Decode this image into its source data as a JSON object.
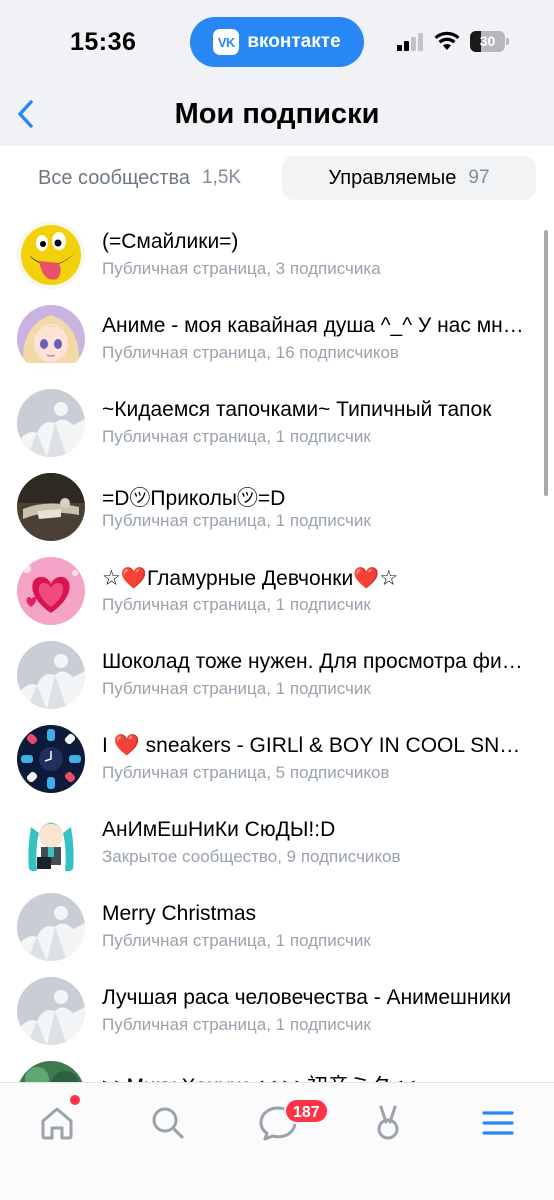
{
  "status_bar": {
    "time": "15:36",
    "app_pill": {
      "logo": "VK",
      "label": "вконтакте"
    },
    "battery_level": "30"
  },
  "header": {
    "title": "Мои подписки"
  },
  "tabs": [
    {
      "label": "Все сообщества",
      "count": "1,5K"
    },
    {
      "label": "Управляемые",
      "count": "97"
    }
  ],
  "communities": [
    {
      "name": "(=Смайлики=)",
      "subtitle": "Публичная страница, 3 подписчика",
      "avatar": "smiley-avatar"
    },
    {
      "name": "Аниме - моя кавайная душа ^_^ У нас много интересного",
      "subtitle": "Публичная страница, 16 подписчиков",
      "avatar": "anime-girl-avatar"
    },
    {
      "name": "~Кидаемся тапочками~ Типичный тапок",
      "subtitle": "Публичная страница, 1 подписчик",
      "avatar": "placeholder-avatar"
    },
    {
      "name": "=D㋡Приколы㋡=D",
      "subtitle": "Публичная страница, 1 подписчик",
      "avatar": "photo-avatar"
    },
    {
      "name_parts": [
        "☆",
        "❤️",
        "Гламурные Девчонки",
        "❤️",
        "☆"
      ],
      "subtitle": "Публичная страница, 1 подписчик",
      "avatar": "hearts-avatar"
    },
    {
      "name": "Шоколад тоже нужен. Для просмотра фильмов",
      "subtitle": "Публичная страница, 1 подписчик",
      "avatar": "placeholder-avatar"
    },
    {
      "name_parts": [
        "I ",
        "❤️",
        " sneakers - GIRLl & BOY IN COOL SNEAKERS"
      ],
      "subtitle": "Публичная страница, 5 подписчиков",
      "avatar": "sneakers-avatar"
    },
    {
      "name": "АнИмЕшНиКи СюДЫ!:D",
      "subtitle": "Закрытое сообщество, 9 подписчиков",
      "avatar": "miku-avatar"
    },
    {
      "name": "Merry Christmas",
      "subtitle": "Публичная страница, 1 подписчик",
      "avatar": "placeholder-avatar"
    },
    {
      "name": "Лучшая раса человечества - Анимешники",
      "subtitle": "Публичная страница, 1 подписчик",
      "avatar": "placeholder-avatar"
    },
    {
      "name": ">>Мику Хацунэ<< >>初音ミク<<",
      "subtitle": "",
      "avatar": "green-avatar"
    }
  ],
  "bottom_nav": {
    "items": [
      "home-icon",
      "search-icon",
      "messenger-icon",
      "services-icon",
      "menu-icon"
    ],
    "messages_badge": "187",
    "active": "menu-icon"
  },
  "colors": {
    "accent": "#2787f5",
    "secondary_text": "#99a2ad",
    "badge": "#ff3347",
    "header_bg": "#f0f2f5"
  }
}
